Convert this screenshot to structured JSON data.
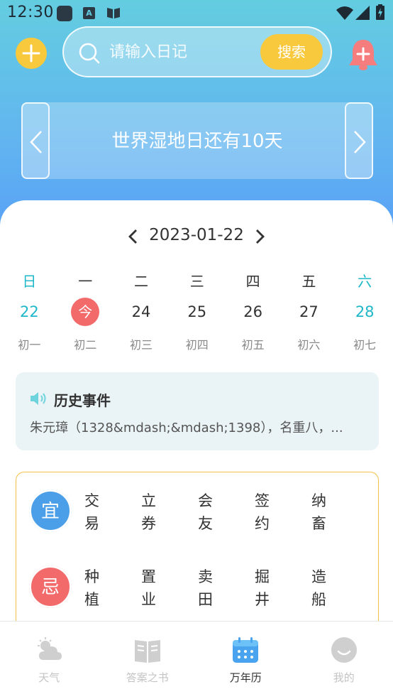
{
  "status_bar": {
    "time": "12:30",
    "app_badge": "A"
  },
  "header": {
    "search_placeholder": "请输入日记",
    "search_button": "搜索"
  },
  "banner": {
    "text": "世界湿地日还有10天"
  },
  "calendar": {
    "current_date": "2023-01-22",
    "weekdays": [
      "日",
      "一",
      "二",
      "三",
      "四",
      "五",
      "六"
    ],
    "days": [
      "22",
      "今",
      "24",
      "25",
      "26",
      "27",
      "28"
    ],
    "lunar": [
      "初一",
      "初二",
      "初三",
      "初四",
      "初五",
      "初六",
      "初七"
    ],
    "today_index": 1,
    "weekend_color": "#1fb8c9",
    "today_color": "#f26a6a"
  },
  "history": {
    "title": "历史事件",
    "text": "朱元璋（1328&mdash;&mdash;1398），名重八，..."
  },
  "almanac": {
    "yi_label": "宜",
    "ji_label": "忌",
    "yi_items": [
      [
        "交",
        "易"
      ],
      [
        "立",
        "券"
      ],
      [
        "会",
        "友"
      ],
      [
        "签",
        "约"
      ],
      [
        "纳",
        "畜"
      ]
    ],
    "ji_items": [
      [
        "种",
        "植"
      ],
      [
        "置",
        "业"
      ],
      [
        "卖",
        "田"
      ],
      [
        "掘",
        "井"
      ],
      [
        "造",
        "船"
      ]
    ],
    "yi_color": "#4a9fe8",
    "ji_color": "#f26a6a"
  },
  "nav": {
    "items": [
      {
        "label": "天气",
        "icon": "weather-icon",
        "active": false
      },
      {
        "label": "答案之书",
        "icon": "book-icon",
        "active": false
      },
      {
        "label": "万年历",
        "icon": "calendar-icon",
        "active": true
      },
      {
        "label": "我的",
        "icon": "profile-icon",
        "active": false
      }
    ]
  },
  "colors": {
    "accent_yellow": "#f8c93c",
    "accent_blue": "#5aa5f5"
  }
}
